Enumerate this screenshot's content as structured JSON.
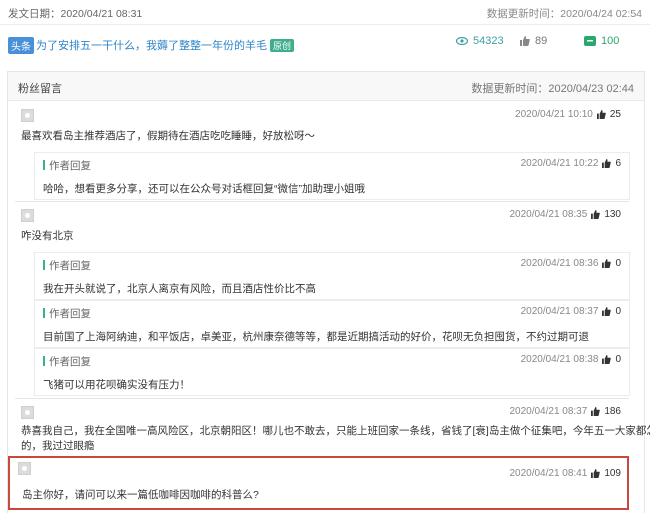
{
  "header": {
    "publish_date": "发文日期：2020/04/21 08:31",
    "data_update": "数据更新时间：2020/04/24 02:54"
  },
  "article": {
    "tag": "头条",
    "title": "为了安排五一干什么，我薅了整整一年份的羊毛",
    "original": "原创",
    "reads": "54323",
    "likes": "89",
    "favorites": "100"
  },
  "panel": {
    "title": "粉丝留言",
    "update": "数据更新时间：2020/04/23 02:44"
  },
  "reply_label": "作者回复",
  "comments": [
    {
      "time": "2020/04/21 10:10",
      "likes": "25",
      "text": "最喜欢看岛主推荐酒店了，假期待在酒店吃吃睡睡，好放松呀～",
      "replies": [
        {
          "time": "2020/04/21 10:22",
          "likes": "6",
          "text": "哈哈，想看更多分享，还可以在公众号对话框回复“微信”加助理小姐哦"
        }
      ]
    },
    {
      "time": "2020/04/21 08:35",
      "likes": "130",
      "text": "咋没有北京",
      "replies": [
        {
          "time": "2020/04/21 08:36",
          "likes": "0",
          "text": "我在开头就说了，北京人离京有风险，而且酒店性价比不高"
        },
        {
          "time": "2020/04/21 08:37",
          "likes": "0",
          "text": "目前国了上海阿纳迪，和平饭店，卓美亚，杭州康奈德等等，都是近期搞活动的好价，花呗无负担囤货，不约过期可退"
        },
        {
          "time": "2020/04/21 08:38",
          "likes": "0",
          "text": "飞猪可以用花呗确实没有压力！"
        }
      ]
    },
    {
      "time": "2020/04/21 08:37",
      "likes": "186",
      "text": "恭喜我自己，我在全国唯一高风险区，北京朝阳区！哪儿也不敢去，只能上班回家一条线，省钱了[衰]岛主做个征集吧，今年五一大家都怎么过的，我过过眼瘾",
      "text_line1": "恭喜我自己，我在全国唯一高风险区，北京朝阳区！哪儿也不敢去，只能上班回家一条线，省钱了[衰]岛主做个征集吧，今年五一大家都怎么过",
      "text_line2": "的，我过过眼瘾",
      "replies": []
    },
    {
      "time": "2020/04/21 08:41",
      "likes": "109",
      "text": "岛主你好，请问可以来一篇低咖啡因咖啡的科普么?",
      "replies": []
    }
  ]
}
